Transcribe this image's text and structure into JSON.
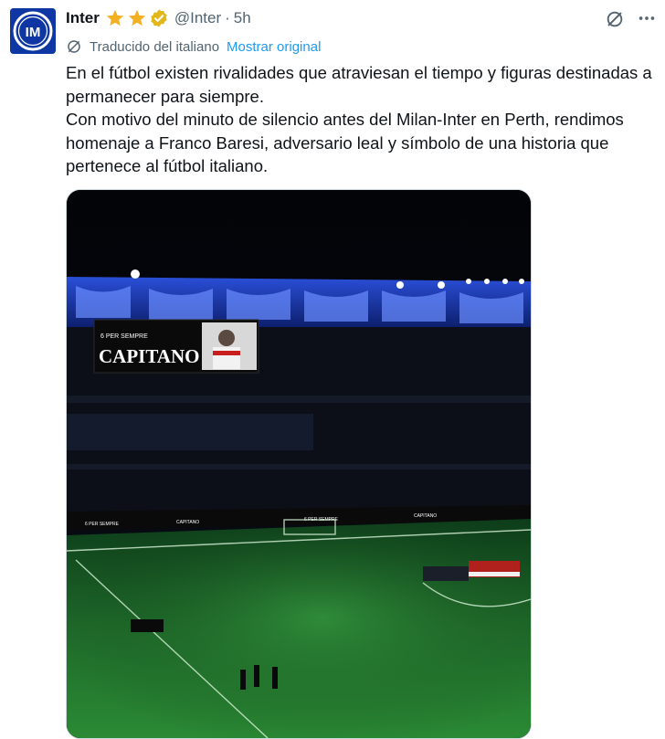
{
  "author": {
    "name": "Inter",
    "handle": "@Inter",
    "separator": "·",
    "time": "5h",
    "avatar_icon": "inter-logo-icon",
    "badges": [
      "star-icon",
      "star-icon",
      "verified-badge-icon"
    ]
  },
  "actions": {
    "grok_icon": "grok-icon",
    "more_icon": "more-icon"
  },
  "translation": {
    "icon": "translate-icon",
    "label": "Traducido del italiano",
    "show_original": "Mostrar original"
  },
  "tweet_text": "En el fútbol existen rivalidades que atraviesan el tiempo y figuras destinadas a permanecer para siempre.\nCon motivo del minuto de silencio antes del Milan-Inter en Perth, rendimos homenaje a Franco Baresi, adversario leal y símbolo de una historia que pertenece al fútbol italiano.",
  "media": {
    "screen_small_text": "6 PER SEMPRE",
    "screen_big_text": "CAPITANO",
    "board_text": [
      "6 PER SEMPRE",
      "CAPITANO"
    ]
  },
  "colors": {
    "accent": "#1d9bf0",
    "star": "#f4b023",
    "verified": "#e2b719",
    "inter_blue": "#0f37a3"
  }
}
